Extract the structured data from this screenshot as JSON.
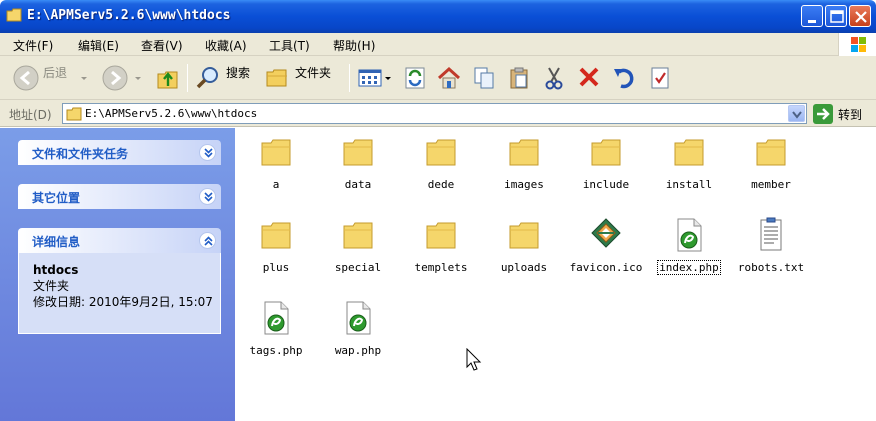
{
  "window": {
    "title": "E:\\APMServ5.2.6\\www\\htdocs"
  },
  "menu": [
    "文件(F)",
    "编辑(E)",
    "查看(V)",
    "收藏(A)",
    "工具(T)",
    "帮助(H)"
  ],
  "toolbar": {
    "back_label": "后退",
    "search_label": "搜索",
    "folders_label": "文件夹"
  },
  "address": {
    "label": "地址(D)",
    "value": "E:\\APMServ5.2.6\\www\\htdocs",
    "go_label": "转到"
  },
  "tasks": {
    "file_tasks_title": "文件和文件夹任务",
    "other_places_title": "其它位置",
    "details_title": "详细信息",
    "detail_name": "htdocs",
    "detail_type": "文件夹",
    "detail_date": "修改日期: 2010年9月2日, 15:07"
  },
  "files": [
    {
      "name": "a",
      "type": "folder"
    },
    {
      "name": "data",
      "type": "folder"
    },
    {
      "name": "dede",
      "type": "folder"
    },
    {
      "name": "images",
      "type": "folder"
    },
    {
      "name": "include",
      "type": "folder"
    },
    {
      "name": "install",
      "type": "folder"
    },
    {
      "name": "member",
      "type": "folder"
    },
    {
      "name": "plus",
      "type": "folder"
    },
    {
      "name": "special",
      "type": "folder"
    },
    {
      "name": "templets",
      "type": "folder"
    },
    {
      "name": "uploads",
      "type": "folder"
    },
    {
      "name": "favicon.ico",
      "type": "icon-file"
    },
    {
      "name": "index.php",
      "type": "php-file"
    },
    {
      "name": "robots.txt",
      "type": "text-file"
    },
    {
      "name": "tags.php",
      "type": "php-file"
    },
    {
      "name": "wap.php",
      "type": "php-file"
    }
  ],
  "colors": {
    "title_bar": "#0a4fd6",
    "task_pane": "#6f8ae0",
    "panel_title": "#215dc6",
    "toolbar_bg": "#ece9d8"
  }
}
